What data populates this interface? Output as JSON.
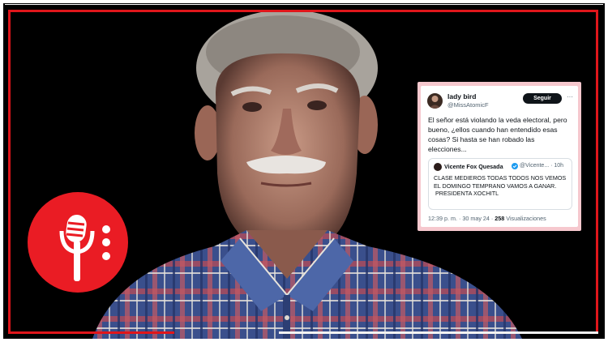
{
  "colors": {
    "frame_red": "#e0161b",
    "badge_red": "#ea1c24",
    "card_pink": "#f6c8ce"
  },
  "badge": {
    "icon": "microphone-icon",
    "dots_icon": "vertical-dots-icon"
  },
  "tweet": {
    "display_name": "lady bird",
    "handle": "@MissAtomicF",
    "follow_label": "Seguir",
    "body": "El señor está violando la veda electoral, pero bueno, ¿ellos cuando han entendido esas cosas? Si hasta se han robado las elecciones...",
    "quoted": {
      "name": "Vicente Fox Quesada",
      "handle": "@Vicente... · 10h",
      "text_line1": "CLASE MEDIEROS TODAS TODOS NOS VEMOS EL DOMINGO TEMPRANO VAMOS A GANAR.",
      "text_line2": "PRESIDENTA XOCHITL"
    },
    "time": "12:39 p. m. · 30 may 24 · ",
    "views_count": "258",
    "views_label": " Visualizaciones"
  }
}
